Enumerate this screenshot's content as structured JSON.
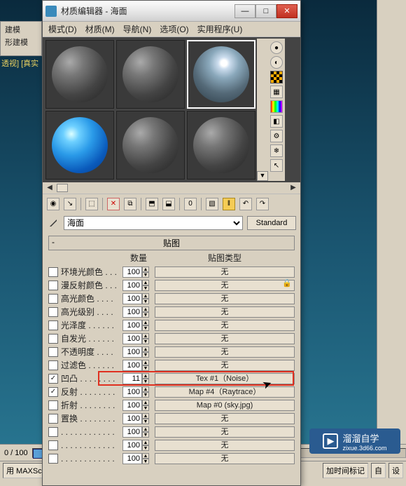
{
  "window": {
    "title": "材质编辑器 - 海面",
    "min": "—",
    "max": "□",
    "close": "✕"
  },
  "menu": {
    "mode": "模式(D)",
    "material": "材质(M)",
    "navigate": "导航(N)",
    "options": "选项(O)",
    "utility": "实用程序(U)"
  },
  "left_panel": {
    "a": "建模",
    "b": "形建模",
    "c": "透视] [真实"
  },
  "name_row": {
    "selected": "海面",
    "type_button": "Standard"
  },
  "rollout": {
    "title": "贴图",
    "col_amount": "数量",
    "col_type": "贴图类型"
  },
  "maps": [
    {
      "on": false,
      "label": "环境光颜色 . . .",
      "amount": "100",
      "map": "无"
    },
    {
      "on": false,
      "label": "漫反射颜色 . . .",
      "amount": "100",
      "map": "无"
    },
    {
      "on": false,
      "label": "高光颜色 . . . .",
      "amount": "100",
      "map": "无"
    },
    {
      "on": false,
      "label": "高光级别 . . . .",
      "amount": "100",
      "map": "无"
    },
    {
      "on": false,
      "label": "光泽度 . . . . . .",
      "amount": "100",
      "map": "无"
    },
    {
      "on": false,
      "label": "自发光 . . . . . .",
      "amount": "100",
      "map": "无"
    },
    {
      "on": false,
      "label": "不透明度 . . . .",
      "amount": "100",
      "map": "无"
    },
    {
      "on": false,
      "label": "过滤色 . . . . . .",
      "amount": "100",
      "map": "无"
    },
    {
      "on": true,
      "label": "凹凸 . . . . . . . .",
      "amount": "11",
      "map": "Tex #1（Noise）"
    },
    {
      "on": true,
      "label": "反射 . . . . . . . .",
      "amount": "100",
      "map": "Map #4（Raytrace）"
    },
    {
      "on": false,
      "label": "折射 . . . . . . . .",
      "amount": "100",
      "map": "Map #0 (sky.jpg)"
    },
    {
      "on": false,
      "label": "置换 . . . . . . . .",
      "amount": "100",
      "map": "无"
    },
    {
      "on": false,
      "label": ". . . . . . . . . . . .",
      "amount": "100",
      "map": "无"
    },
    {
      "on": false,
      "label": ". . . . . . . . . . . .",
      "amount": "100",
      "map": "无"
    },
    {
      "on": false,
      "label": ". . . . . . . . . . . .",
      "amount": "100",
      "map": "无"
    }
  ],
  "timeline": {
    "range": "0 / 100"
  },
  "status": {
    "maxscript": "用  MAXSc",
    "addtime": "加时间标记",
    "auto": "自",
    "set": "设"
  },
  "logo": {
    "text": "溜溜自学",
    "url": "zixue.3d66.com"
  },
  "right_panel": {
    "label": ""
  }
}
